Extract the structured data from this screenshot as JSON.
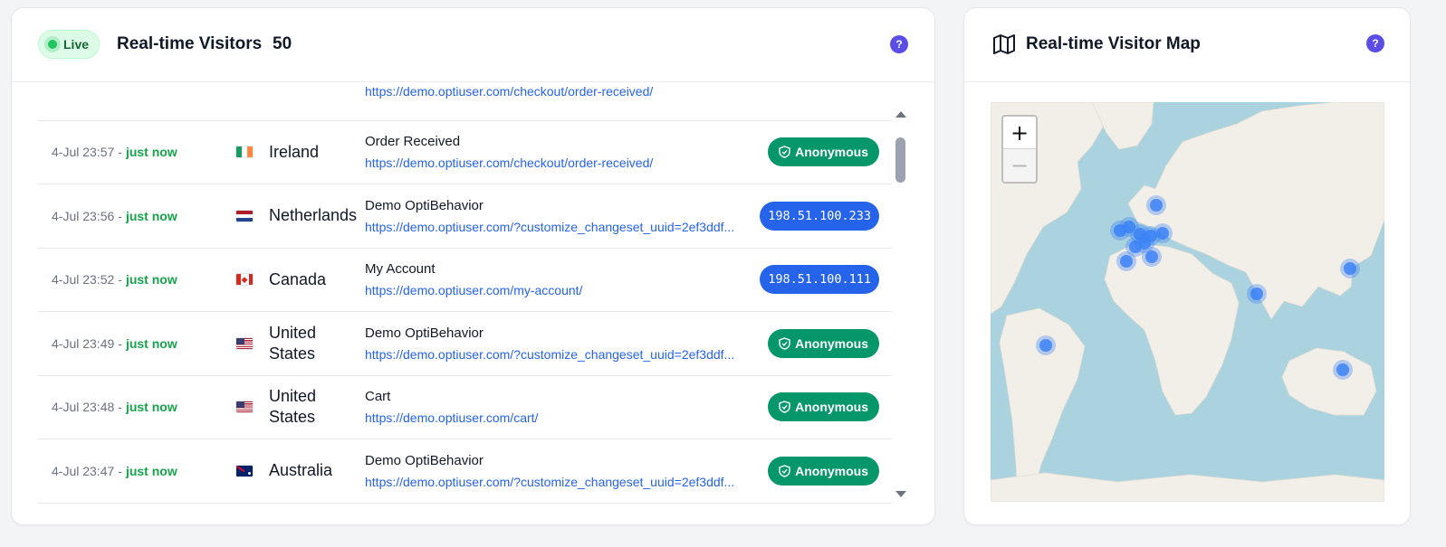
{
  "visitors_panel": {
    "live_label": "Live",
    "title": "Real-time Visitors",
    "count": "50",
    "help": "?"
  },
  "rows": [
    {
      "date": "",
      "ago": "",
      "country": "",
      "flag": "",
      "page_title": "",
      "url": "https://demo.optiuser.com/checkout/order-received/",
      "badge_type": "anon",
      "badge": ""
    },
    {
      "date": "4-Jul 23:57",
      "ago": "just now",
      "country": "Ireland",
      "flag": "ie",
      "page_title": "Order Received",
      "url": "https://demo.optiuser.com/checkout/order-received/",
      "badge_type": "anon",
      "badge": "Anonymous"
    },
    {
      "date": "4-Jul 23:56",
      "ago": "just now",
      "country": "Netherlands",
      "flag": "nl",
      "page_title": "Demo OptiBehavior",
      "url": "https://demo.optiuser.com/?customize_changeset_uuid=2ef3ddf...",
      "badge_type": "ip",
      "badge": "198.51.100.233"
    },
    {
      "date": "4-Jul 23:52",
      "ago": "just now",
      "country": "Canada",
      "flag": "ca",
      "page_title": "My Account",
      "url": "https://demo.optiuser.com/my-account/",
      "badge_type": "ip",
      "badge": "198.51.100.111"
    },
    {
      "date": "4-Jul 23:49",
      "ago": "just now",
      "country": "United States",
      "flag": "us",
      "page_title": "Demo OptiBehavior",
      "url": "https://demo.optiuser.com/?customize_changeset_uuid=2ef3ddf...",
      "badge_type": "anon",
      "badge": "Anonymous"
    },
    {
      "date": "4-Jul 23:48",
      "ago": "just now",
      "country": "United States",
      "flag": "us",
      "page_title": "Cart",
      "url": "https://demo.optiuser.com/cart/",
      "badge_type": "anon",
      "badge": "Anonymous"
    },
    {
      "date": "4-Jul 23:47",
      "ago": "just now",
      "country": "Australia",
      "flag": "au",
      "page_title": "Demo OptiBehavior",
      "url": "https://demo.optiuser.com/?customize_changeset_uuid=2ef3ddf...",
      "badge_type": "anon",
      "badge": "Anonymous"
    }
  ],
  "map_panel": {
    "title": "Real-time Visitor Map",
    "help": "?",
    "zoom_in": "+",
    "zoom_out": "−",
    "icon": "map-icon"
  },
  "colors": {
    "live_green": "#22c55e",
    "anonymous_badge": "#059669",
    "ip_badge": "#2563eb",
    "link": "#2563eb",
    "help": "#5b4ee6",
    "ocean": "#aad3df",
    "land": "#f2efe9",
    "marker": "#3b82f6"
  }
}
